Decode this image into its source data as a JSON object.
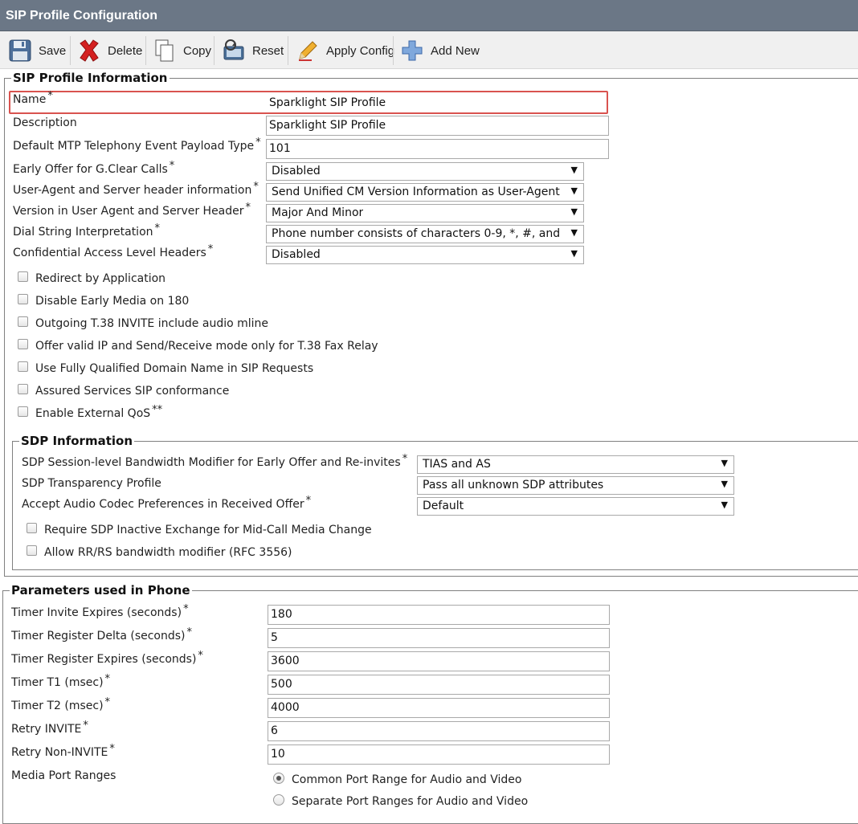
{
  "title": "SIP Profile Configuration",
  "toolbar": {
    "save": "Save",
    "delete": "Delete",
    "copy": "Copy",
    "reset": "Reset",
    "apply_config": "Apply Config",
    "add_new": "Add New"
  },
  "sip_profile_info": {
    "legend": "SIP Profile Information",
    "name_label": "Name",
    "name_value": "Sparklight SIP Profile",
    "description_label": "Description",
    "description_value": "Sparklight SIP Profile",
    "mtp_label": "Default MTP Telephony Event Payload Type",
    "mtp_value": "101",
    "gclear_label": "Early Offer for G.Clear Calls",
    "gclear_value": "Disabled",
    "ua_header_label": "User-Agent and Server header information",
    "ua_header_value": "Send Unified CM Version Information as User-Agent",
    "version_label": "Version in User Agent and Server Header",
    "version_value": "Major And Minor",
    "dial_string_label": "Dial String Interpretation",
    "dial_string_value": "Phone number consists of characters 0-9, *, #, and",
    "confidential_label": "Confidential Access Level Headers",
    "confidential_value": "Disabled",
    "req_mark": "*",
    "qos_mark": "**",
    "checkboxes": {
      "redirect": "Redirect by Application",
      "early_media": "Disable Early Media on 180",
      "t38_audio": "Outgoing T.38 INVITE include audio mline",
      "t38_fax": "Offer valid IP and Send/Receive mode only for T.38 Fax Relay",
      "fqdn": "Use Fully Qualified Domain Name in SIP Requests",
      "assured": "Assured Services SIP conformance",
      "qos": "Enable External QoS"
    }
  },
  "sdp_info": {
    "legend": "SDP Information",
    "bandwidth_label": "SDP Session-level Bandwidth Modifier for Early Offer and Re-invites",
    "bandwidth_value": "TIAS and AS",
    "transparency_label": "SDP Transparency Profile",
    "transparency_value": "Pass all unknown SDP attributes",
    "codec_label": "Accept Audio Codec Preferences in Received Offer",
    "codec_value": "Default",
    "inactive_exchange": "Require SDP Inactive Exchange for Mid-Call Media Change",
    "rr_rs": "Allow RR/RS bandwidth modifier (RFC 3556)"
  },
  "phone_params": {
    "legend": "Parameters used in Phone",
    "timer_invite_label": "Timer Invite Expires (seconds)",
    "timer_invite_value": "180",
    "timer_reg_delta_label": "Timer Register Delta (seconds)",
    "timer_reg_delta_value": "5",
    "timer_reg_expires_label": "Timer Register Expires (seconds)",
    "timer_reg_expires_value": "3600",
    "timer_t1_label": "Timer T1 (msec)",
    "timer_t1_value": "500",
    "timer_t2_label": "Timer T2 (msec)",
    "timer_t2_value": "4000",
    "retry_invite_label": "Retry INVITE",
    "retry_invite_value": "6",
    "retry_non_invite_label": "Retry Non-INVITE",
    "retry_non_invite_value": "10",
    "media_port_label": "Media Port Ranges",
    "common_range": "Common Port Range for Audio and Video",
    "separate_range": "Separate Port Ranges for Audio and Video"
  },
  "colors": {
    "title_bar": "#6b7786",
    "highlight": "#d9534f",
    "delete_icon": "#d42020",
    "add_icon": "#5b8fd1"
  }
}
